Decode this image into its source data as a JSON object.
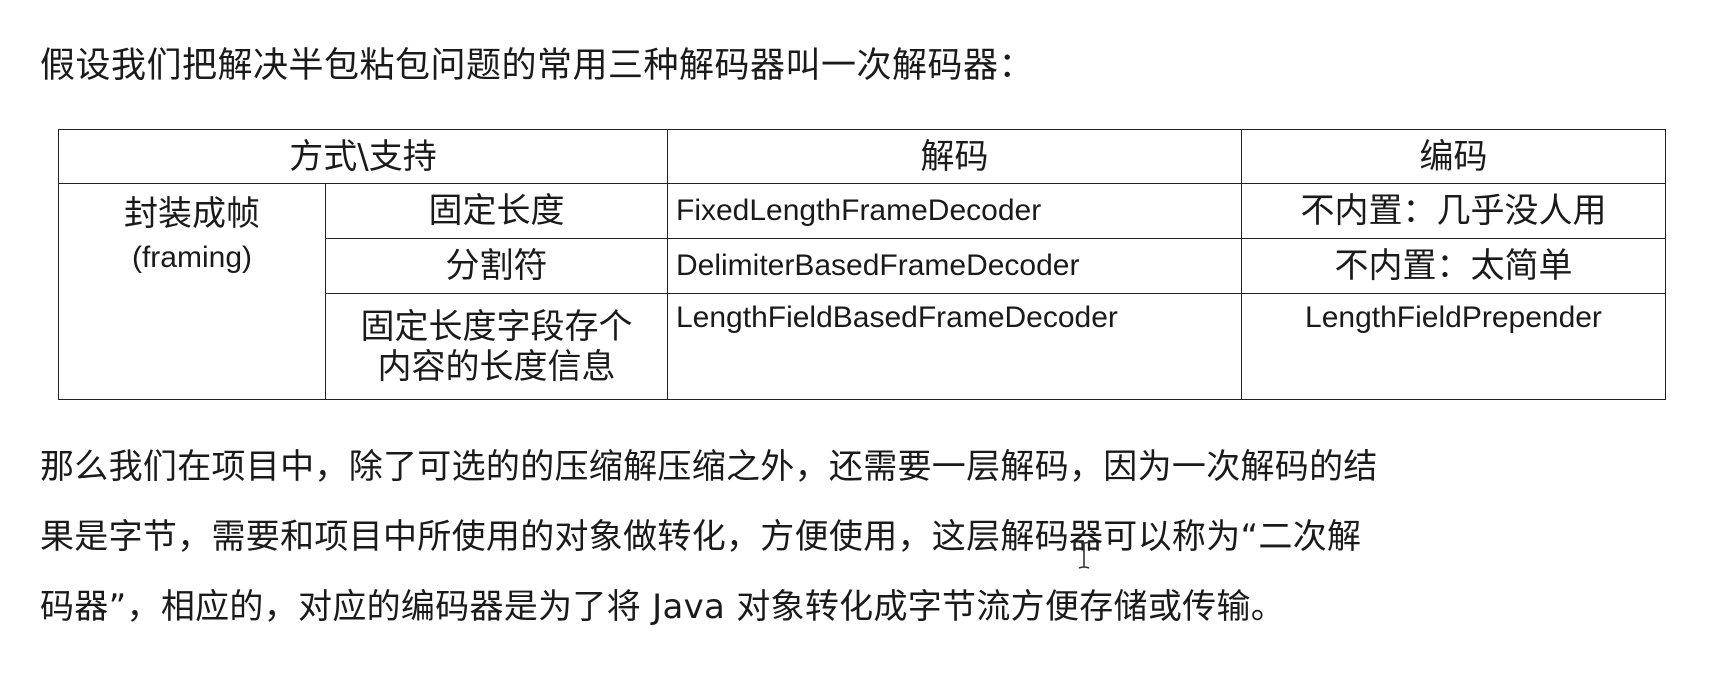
{
  "intro": "假设我们把解决半包粘包问题的常用三种解码器叫一次解码器：",
  "table": {
    "header": {
      "mode": "方式\\支持",
      "decode": "解码",
      "encode": "编码"
    },
    "framing": {
      "label": "封装成帧",
      "sub": "(framing)"
    },
    "rows": [
      {
        "method": "固定长度",
        "decoder": "FixedLengthFrameDecoder",
        "encoder": "不内置：几乎没人用"
      },
      {
        "method": "分割符",
        "decoder": "DelimiterBasedFrameDecoder",
        "encoder": "不内置：太简单"
      },
      {
        "method_line1": "固定长度字段存个",
        "method_line2": "内容的长度信息",
        "decoder": "LengthFieldBasedFrameDecoder",
        "encoder": "LengthFieldPrepender"
      }
    ]
  },
  "paragraph": [
    "那么我们在项目中，除了可选的的压缩解压缩之外，还需要一层解码，因为一次解码的结",
    "果是字节，需要和项目中所使用的对象做转化，方便使用，这层解码器可以称为“二次解",
    "码器”，相应的，对应的编码器是为了将 Java 对象转化成字节流方便存储或传输。"
  ]
}
